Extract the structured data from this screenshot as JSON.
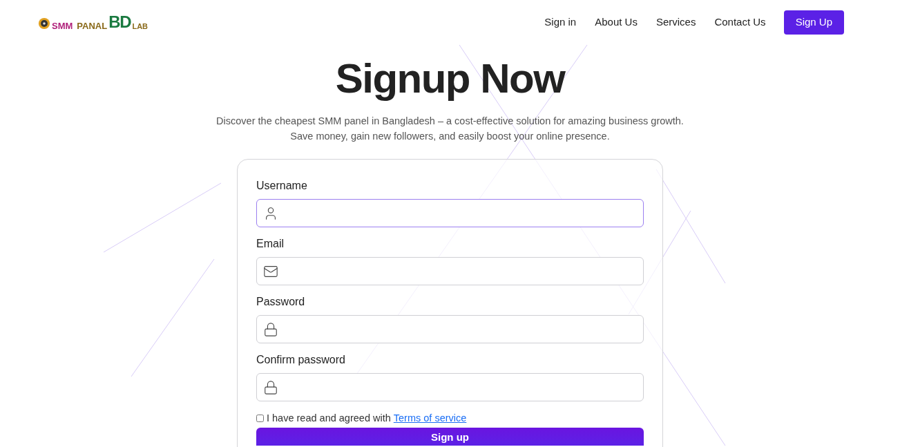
{
  "header": {
    "logo": {
      "part_1": "SMM",
      "part_2": "PANAL",
      "part_3": "BD",
      "part_4": "LAB"
    },
    "nav": [
      {
        "label": "Sign in",
        "kind": "link"
      },
      {
        "label": "About Us",
        "kind": "link"
      },
      {
        "label": "Services",
        "kind": "link"
      },
      {
        "label": "Contact Us",
        "kind": "link"
      },
      {
        "label": "Sign Up",
        "kind": "button"
      }
    ]
  },
  "hero": {
    "title": "Signup Now",
    "subtitle_lines": [
      "Discover the cheapest SMM panel in Bangladesh – a cost-effective solution for amazing business growth.",
      "Save money, gain new followers, and easily boost your online presence."
    ]
  },
  "form": {
    "fields": [
      {
        "label": "Username",
        "kind": "user",
        "focused": true
      },
      {
        "label": "Email",
        "kind": "email",
        "focused": false
      },
      {
        "label": "Password",
        "kind": "password",
        "focused": false
      },
      {
        "label": "Confirm password",
        "kind": "password",
        "focused": false
      }
    ],
    "agreement": {
      "text": "I have read and agreed with",
      "link": "Terms of service",
      "checked": false
    },
    "submit": "Sign up"
  }
}
